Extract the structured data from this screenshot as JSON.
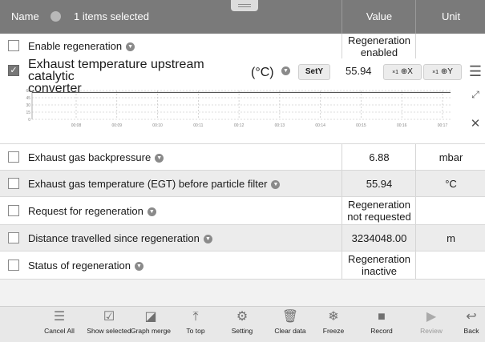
{
  "header": {
    "name": "Name",
    "selection": "1 items selected",
    "value": "Value",
    "unit": "Unit"
  },
  "rows": [
    {
      "label": "Enable regeneration",
      "value_line1": "Regeneration",
      "value_line2": "enabled",
      "unit": ""
    },
    {
      "label": "Exhaust gas backpressure",
      "value": "6.88",
      "unit": "mbar"
    },
    {
      "label": "Exhaust gas temperature (EGT) before particle filter",
      "value": "55.94",
      "unit": "°C"
    },
    {
      "label": "Request for regeneration",
      "value_line1": "Regeneration",
      "value_line2": "not requested",
      "unit": ""
    },
    {
      "label": "Distance travelled since regeneration",
      "value": "3234048.00",
      "unit": "m"
    },
    {
      "label": "Status of regeneration",
      "value_line1": "Regeneration",
      "value_line2": "inactive",
      "unit": ""
    }
  ],
  "graph_row": {
    "label_line1": "Exhaust temperature upstream catalytic",
    "label_line2": "converter",
    "unit": "(°C)",
    "sety_label": "SetY",
    "value": "55.94",
    "zoom_x_label": "X",
    "zoom_y_label": "Y",
    "zoom_prefix": "×1",
    "chart_data": {
      "type": "line",
      "y_ticks": [
        "60",
        "45",
        "30",
        "15",
        "0"
      ],
      "x_ticks": [
        "00:08",
        "00:09",
        "00:10",
        "00:11",
        "00:12",
        "00:13",
        "00:14",
        "00:15",
        "00:16",
        "00:17"
      ],
      "series": [
        {
          "values": [
            55.94,
            55.94,
            55.94,
            55.94,
            55.94,
            55.94,
            55.94,
            55.94,
            55.94,
            55.94
          ]
        }
      ],
      "ylim": [
        0,
        60
      ]
    }
  },
  "toolbar": [
    {
      "label": "Cancel All",
      "icon": "cancel-all-icon",
      "glyph": "☰"
    },
    {
      "label": "Show selected",
      "icon": "show-selected-icon",
      "glyph": "☑"
    },
    {
      "label": "Graph merge",
      "icon": "graph-merge-icon",
      "glyph": "◪"
    },
    {
      "label": "To top",
      "icon": "to-top-icon",
      "glyph": "⤒"
    },
    {
      "label": "Setting",
      "icon": "setting-icon",
      "glyph": "⚙"
    },
    {
      "label": "Clear data",
      "icon": "clear-data-icon",
      "glyph": "🗑"
    },
    {
      "label": "Freeze",
      "icon": "freeze-icon",
      "glyph": "❄"
    },
    {
      "label": "Record",
      "icon": "record-icon",
      "glyph": "■"
    },
    {
      "label": "Review",
      "icon": "review-icon",
      "glyph": "▶",
      "disabled": true
    },
    {
      "label": "Back",
      "icon": "back-icon",
      "glyph": "↩"
    }
  ]
}
